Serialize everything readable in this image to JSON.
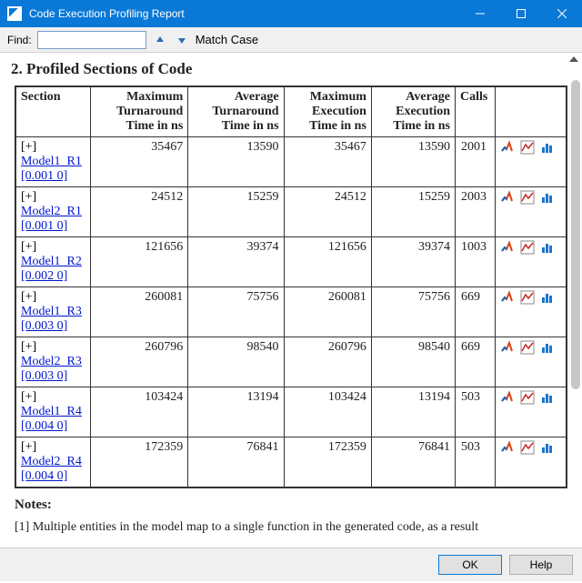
{
  "window": {
    "title": "Code Execution Profiling Report"
  },
  "findbar": {
    "label": "Find:",
    "value": "",
    "match_case": "Match Case"
  },
  "heading": "2. Profiled Sections of Code",
  "columns": {
    "section": "Section",
    "max_turn": "Maximum Turnaround Time in ns",
    "avg_turn": "Average Turnaround Time in ns",
    "max_exec": "Maximum Execution Time in ns",
    "avg_exec": "Average Execution Time in ns",
    "calls": "Calls"
  },
  "rows": [
    {
      "name": "Model1_R1",
      "sub": "[0.001 0]",
      "max_turn": "35467",
      "avg_turn": "13590",
      "max_exec": "35467",
      "avg_exec": "13590",
      "calls": "2001"
    },
    {
      "name": "Model2_R1",
      "sub": "[0.001 0]",
      "max_turn": "24512",
      "avg_turn": "15259",
      "max_exec": "24512",
      "avg_exec": "15259",
      "calls": "2003"
    },
    {
      "name": "Model1_R2",
      "sub": "[0.002 0]",
      "max_turn": "121656",
      "avg_turn": "39374",
      "max_exec": "121656",
      "avg_exec": "39374",
      "calls": "1003"
    },
    {
      "name": "Model1_R3",
      "sub": "[0.003 0]",
      "max_turn": "260081",
      "avg_turn": "75756",
      "max_exec": "260081",
      "avg_exec": "75756",
      "calls": "669"
    },
    {
      "name": "Model2_R3",
      "sub": "[0.003 0]",
      "max_turn": "260796",
      "avg_turn": "98540",
      "max_exec": "260796",
      "avg_exec": "98540",
      "calls": "669"
    },
    {
      "name": "Model1_R4",
      "sub": "[0.004 0]",
      "max_turn": "103424",
      "avg_turn": "13194",
      "max_exec": "103424",
      "avg_exec": "13194",
      "calls": "503"
    },
    {
      "name": "Model2_R4",
      "sub": "[0.004 0]",
      "max_turn": "172359",
      "avg_turn": "76841",
      "max_exec": "172359",
      "avg_exec": "76841",
      "calls": "503"
    }
  ],
  "notes": {
    "heading": "Notes:",
    "line1": "[1] Multiple entities in the model map to a single function in the generated code, as a result"
  },
  "buttons": {
    "ok": "OK",
    "help": "Help"
  },
  "icons": {
    "matlab": "matlab-icon",
    "plot": "plot-icon",
    "bar": "bar-chart-icon"
  }
}
